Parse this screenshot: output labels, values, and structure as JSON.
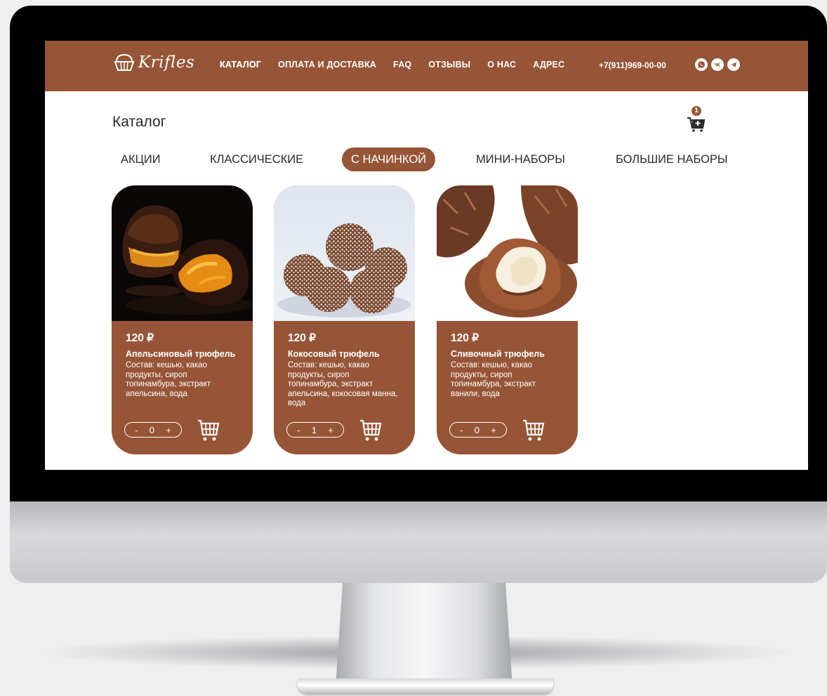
{
  "header": {
    "logo_text": "Krifles",
    "nav": [
      {
        "label": "КАТАЛОГ",
        "active": true
      },
      {
        "label": "ОПЛАТА И ДОСТАВКА"
      },
      {
        "label": "FAQ"
      },
      {
        "label": "ОТЗЫВЫ"
      },
      {
        "label": "О НАС"
      },
      {
        "label": "АДРЕС"
      }
    ],
    "phone": "+7(911)969-00-00",
    "socials": [
      "whatsapp-icon",
      "vk-icon",
      "telegram-icon"
    ]
  },
  "page": {
    "title": "Каталог",
    "cart_count": "1"
  },
  "tabs": [
    {
      "label": "АКЦИИ"
    },
    {
      "label": "КЛАССИЧЕСКИЕ"
    },
    {
      "label": "С НАЧИНКОЙ",
      "active": true
    },
    {
      "label": "МИНИ-НАБОРЫ"
    },
    {
      "label": "БОЛЬШИЕ НАБОРЫ"
    }
  ],
  "products": [
    {
      "price": "120 ₽",
      "name": "Апельсиновый трюфель",
      "description": "Состав: кешью, какао продукты, сироп топинамбура, экстракт апельсина, вода",
      "qty": "0"
    },
    {
      "price": "120 ₽",
      "name": "Кокосовый трюфель",
      "description": "Состав: кешью, какао продукты, сироп топинамбура, экстракт апельсина, кокосовая манна, вода",
      "qty": "1"
    },
    {
      "price": "120 ₽",
      "name": "Сливочный трюфель",
      "description": "Состав: кешью, какао продукты, сироп топинамбура, экстракт ванили, вода",
      "qty": "0"
    }
  ],
  "qty_controls": {
    "minus": "-",
    "plus": "+"
  },
  "colors": {
    "brand": "#975537",
    "text": "#2b2b2b",
    "screen_bg": "#ffffff",
    "bezel": "#000000"
  }
}
